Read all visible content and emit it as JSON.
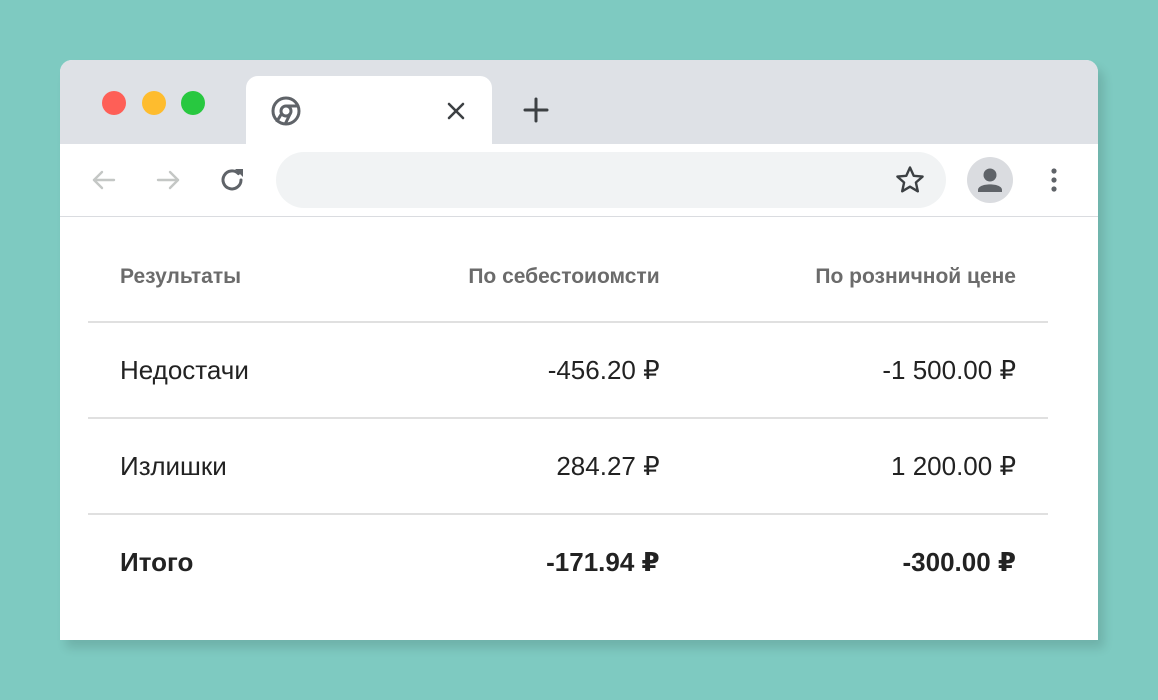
{
  "browser": {
    "tab_title": "",
    "address": "",
    "window_controls": [
      "close",
      "minimize",
      "maximize"
    ],
    "icons": {
      "favicon": "chrome-icon",
      "tab_close": "close-icon",
      "new_tab": "plus-icon",
      "back": "back-arrow-icon",
      "forward": "forward-arrow-icon",
      "reload": "reload-icon",
      "bookmark": "star-icon",
      "profile": "profile-icon",
      "menu": "more-vert-icon"
    }
  },
  "table": {
    "headers": [
      "Результаты",
      "По себестоиомсти",
      "По розничной цене"
    ],
    "rows": [
      [
        "Недостачи",
        "-456.20 ₽",
        "-1 500.00 ₽"
      ],
      [
        "Излишки",
        "284.27 ₽",
        "1 200.00 ₽"
      ]
    ],
    "total": [
      "Итого",
      "-171.94 ₽",
      "-300.00 ₽"
    ]
  },
  "colors": {
    "background": "#7ecac1",
    "tab_bar": "#dee1e6",
    "close_dot": "#fe5f57",
    "minimize_dot": "#febc2e",
    "maximize_dot": "#28c840"
  }
}
